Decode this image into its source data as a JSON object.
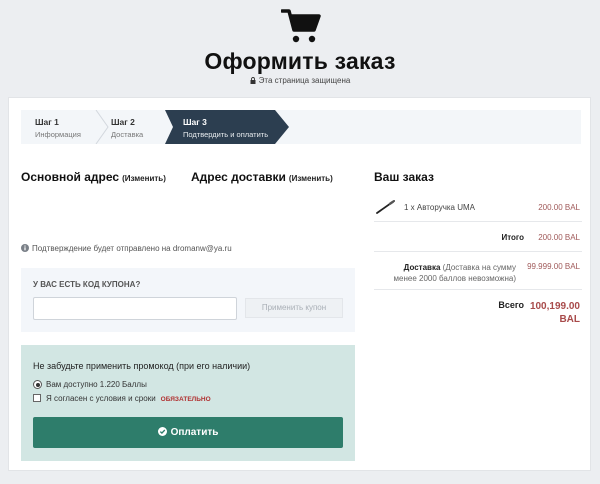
{
  "header": {
    "title": "Оформить заказ",
    "secure_text": "Эта страница защищена"
  },
  "steps": [
    {
      "title": "Шаг 1",
      "subtitle": "Информация"
    },
    {
      "title": "Шаг 2",
      "subtitle": "Доставка"
    },
    {
      "title": "Шаг 3",
      "subtitle": "Подтвердить и оплатить",
      "active": true
    }
  ],
  "address": {
    "main_title": "Основной адрес",
    "main_change": "(Изменить)",
    "shipping_title": "Адрес доставки",
    "shipping_change": "(Изменить)",
    "confirmation_note": "Подтверждение будет отправлено на dromanw@ya.ru"
  },
  "coupon": {
    "label": "У ВАС ЕСТЬ КОД КУПОНА?",
    "input_value": "",
    "input_placeholder": "",
    "apply_label": "Применить купон"
  },
  "promo": {
    "reminder": "Не забудьте применить промокод (при его наличии)",
    "points_option": "Вам доступно 1.220 Баллы",
    "points_selected": true,
    "terms_option": "Я согласен с условия и сроки",
    "terms_checked": false,
    "required_label": "ОБЯЗАТЕЛЬНО",
    "pay_label": "Оплатить"
  },
  "order": {
    "title": "Ваш заказ",
    "items": [
      {
        "icon": "pen-icon",
        "name": "1 x Авторучка UMA",
        "price": "200.00 BAL"
      }
    ],
    "total_label": "Итого",
    "total_value": "200.00 BAL",
    "shipping_label": "Доставка",
    "shipping_note": "(Доставка на сумму менее 2000 баллов невозможна)",
    "shipping_value": "99.999.00 BAL",
    "grand_label": "Всего",
    "grand_value": "100,199.00 BAL"
  },
  "colors": {
    "active_step": "#2c3e50",
    "pay_button": "#2e7d6b",
    "promo_background": "#d2e6e3",
    "price_text": "#a05a5a",
    "required_text": "#b03030"
  }
}
